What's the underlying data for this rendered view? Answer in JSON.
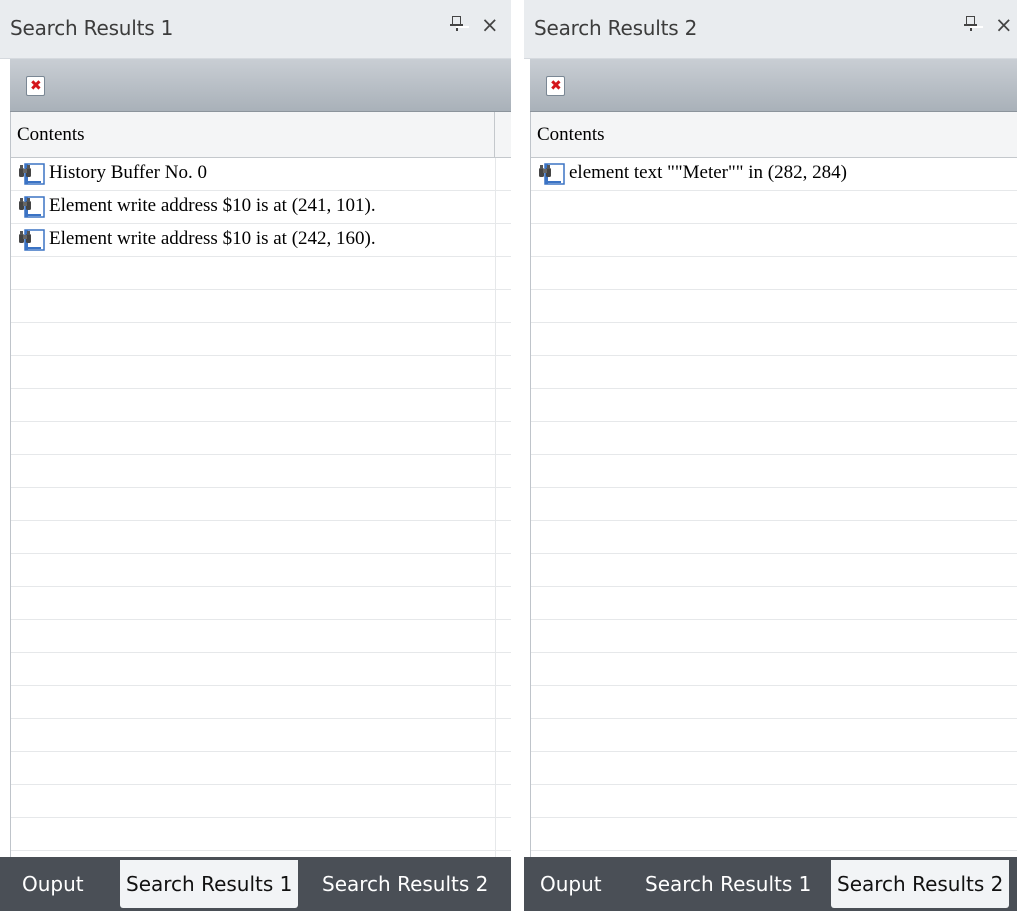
{
  "panes": [
    {
      "title": "Search Results 1",
      "column_header": "Contents",
      "rows": [
        "History Buffer No. 0",
        "Element write address $10 is at (241, 101).",
        "Element write address $10 is at (242, 160)."
      ],
      "tabs": [
        "Ouput",
        "Search Results 1",
        "Search Results 2"
      ],
      "active_tab": 1
    },
    {
      "title": "Search Results 2",
      "column_header": "Contents",
      "rows": [
        "element text  \"\"Meter\"\" in (282, 284)"
      ],
      "tabs": [
        "Ouput",
        "Search Results 1",
        "Search Results 2"
      ],
      "active_tab": 2
    }
  ],
  "icons": {
    "pin": "pin-icon",
    "close": "close-icon",
    "clear": "clear-results-icon",
    "row": "binoculars-doc-icon"
  },
  "colors": {
    "toolbar_top": "#c9ced4",
    "toolbar_bottom": "#a9b1b9",
    "tabbar": "#4a4f56",
    "clear_x": "#d4161b"
  }
}
